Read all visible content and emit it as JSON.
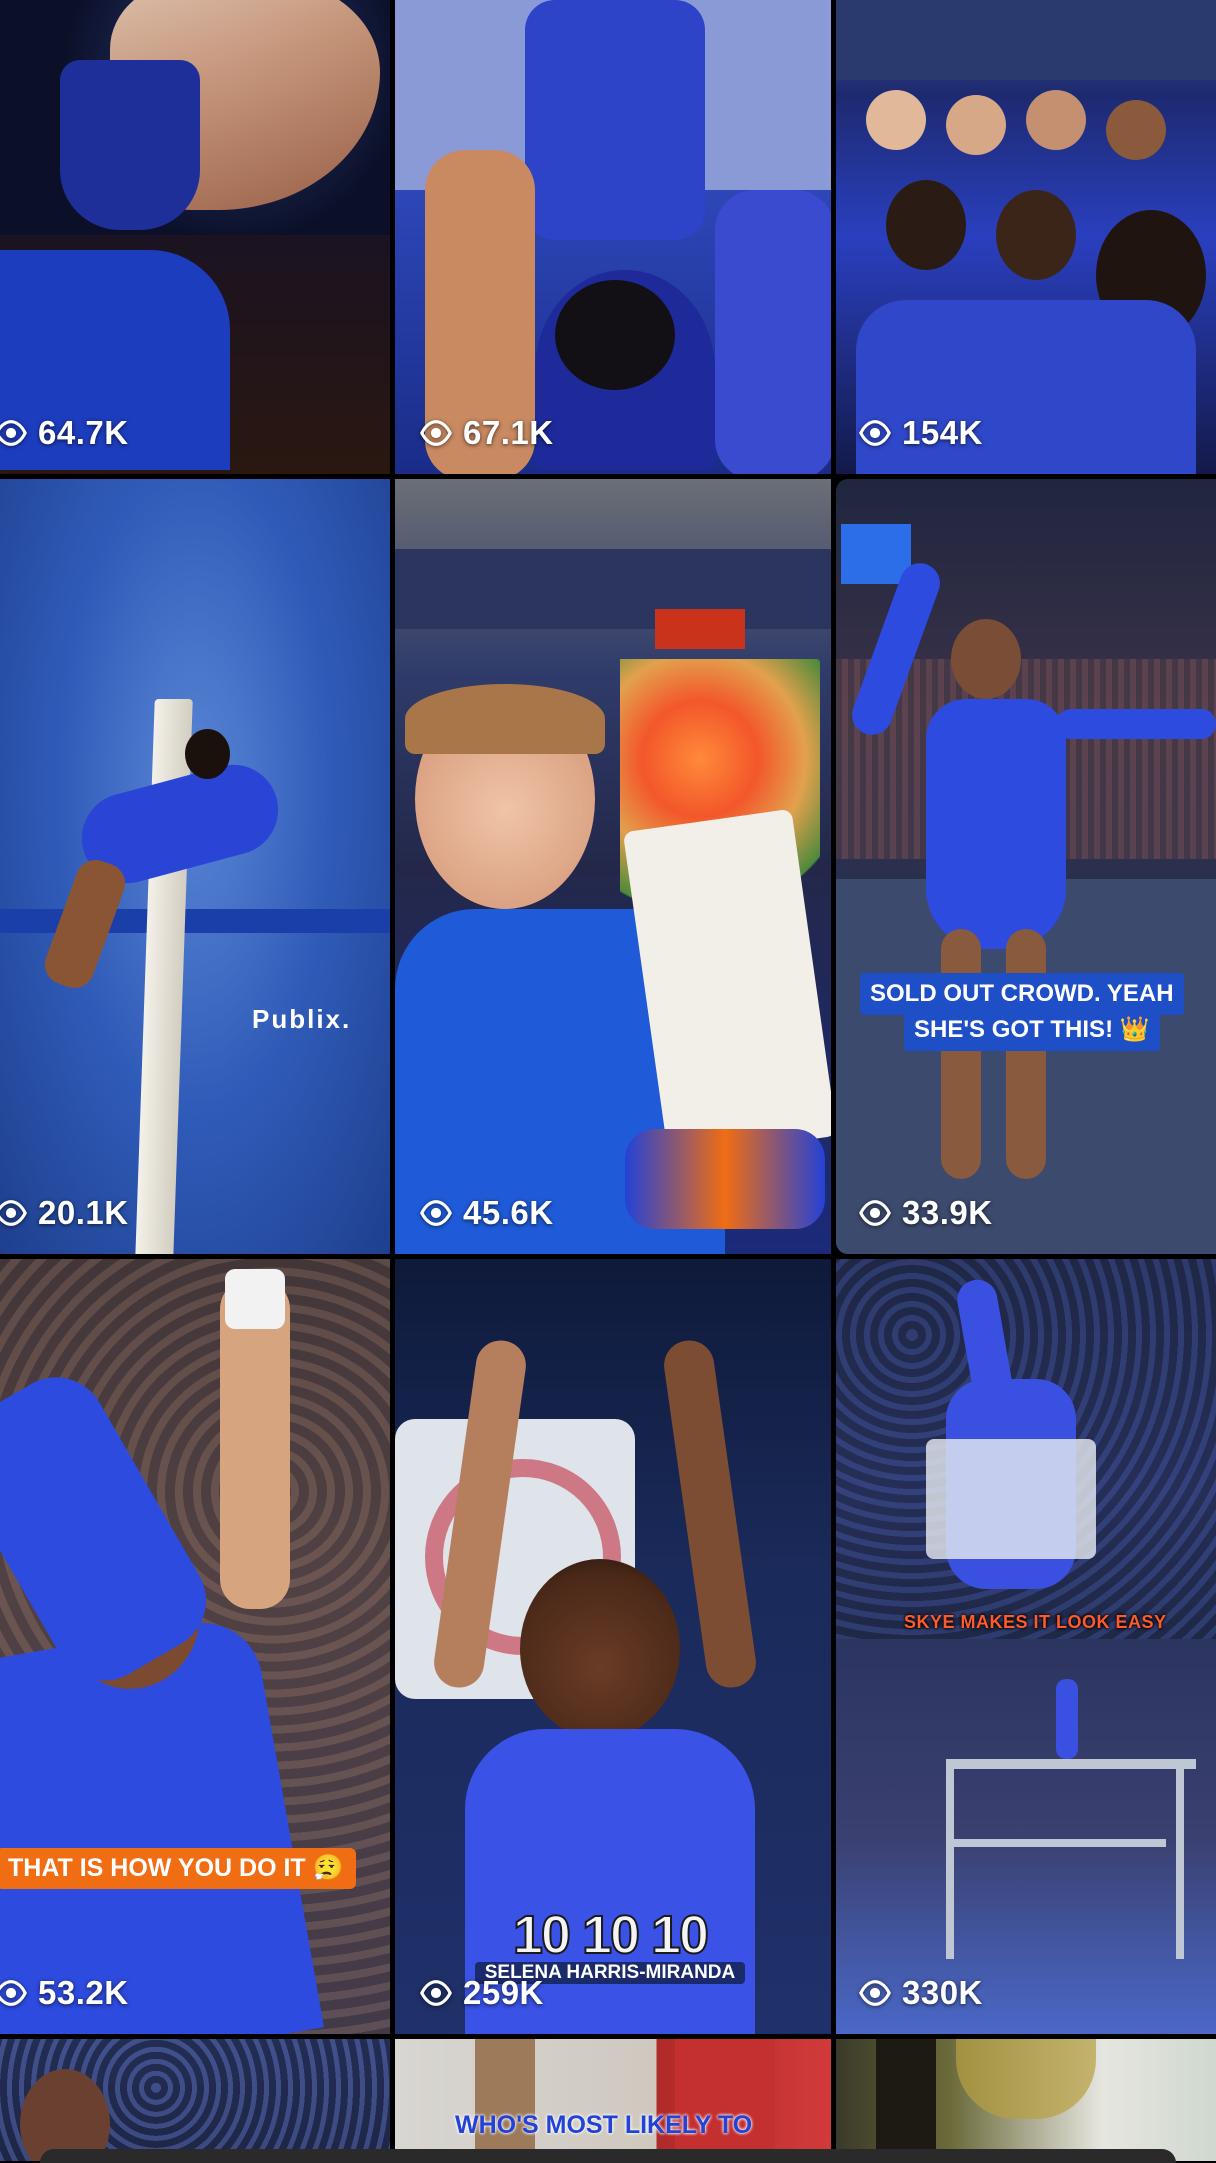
{
  "tiles": [
    {
      "views": "64.7K"
    },
    {
      "views": "67.1K"
    },
    {
      "views": "154K"
    },
    {
      "views": "20.1K",
      "logo": "Publix."
    },
    {
      "views": "45.6K"
    },
    {
      "views": "33.9K",
      "caption_line1": "SOLD OUT CROWD. YEAH",
      "caption_line2": "SHE'S GOT THIS! 👑"
    },
    {
      "views": "53.2K",
      "caption": "THAT IS HOW YOU DO IT 😮‍💨"
    },
    {
      "views": "259K",
      "score": "10 10 10",
      "name": "SELENA HARRIS-MIRANDA"
    },
    {
      "views": "330K",
      "caption": "SKYE MAKES IT LOOK EASY"
    },
    {},
    {
      "caption": "WHO'S MOST LIKELY TO"
    },
    {}
  ],
  "icons": {
    "views": "eye-icon"
  },
  "colors": {
    "florida_blue": "#2a4fd6",
    "florida_orange": "#f06d14"
  }
}
